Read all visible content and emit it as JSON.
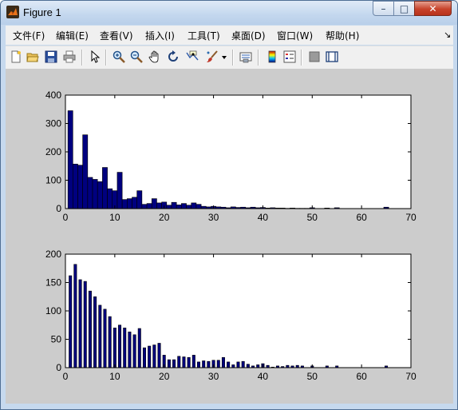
{
  "window": {
    "title": "Figure 1",
    "min_glyph": "–",
    "max_glyph": "□",
    "close_glyph": "✕"
  },
  "menu": {
    "items": [
      "文件(F)",
      "编辑(E)",
      "查看(V)",
      "插入(I)",
      "工具(T)",
      "桌面(D)",
      "窗口(W)",
      "帮助(H)"
    ],
    "dock_glyph": "↘"
  },
  "toolbar": {
    "icons": [
      "new-figure-icon",
      "open-file-icon",
      "save-icon",
      "print-icon",
      "edit-plot-arrow-icon",
      "zoom-in-icon",
      "zoom-out-icon",
      "pan-hand-icon",
      "rotate-3d-icon",
      "data-cursor-icon",
      "brush-icon",
      "brush-dropdown-icon",
      "link-plot-icon",
      "colorbar-icon",
      "legend-icon",
      "hide-plot-tools-icon",
      "show-plot-tools-icon"
    ]
  },
  "colors": {
    "bar_fill": "#00007f",
    "bar_edge": "#000000",
    "figure_bg": "#cccccc",
    "axes_bg": "#ffffff"
  },
  "chart_data": [
    {
      "type": "bar",
      "xlim": [
        0,
        70
      ],
      "ylim": [
        0,
        400
      ],
      "xticks": [
        "0",
        "10",
        "20",
        "30",
        "40",
        "50",
        "60",
        "70"
      ],
      "yticks": [
        "0",
        "100",
        "200",
        "300",
        "400"
      ],
      "bar_width": 1,
      "grid": false,
      "x": [
        1,
        2,
        3,
        4,
        5,
        6,
        7,
        8,
        9,
        10,
        11,
        12,
        13,
        14,
        15,
        16,
        17,
        18,
        19,
        20,
        21,
        22,
        23,
        24,
        25,
        26,
        27,
        28,
        29,
        30,
        31,
        32,
        33,
        34,
        35,
        36,
        37,
        38,
        39,
        40,
        41,
        42,
        43,
        44,
        45,
        46,
        47,
        48,
        49,
        50,
        53,
        55,
        65
      ],
      "values": [
        345,
        157,
        153,
        260,
        110,
        103,
        95,
        145,
        70,
        63,
        128,
        32,
        35,
        40,
        63,
        15,
        18,
        35,
        20,
        23,
        12,
        22,
        13,
        18,
        12,
        20,
        15,
        8,
        6,
        8,
        6,
        5,
        3,
        6,
        4,
        5,
        3,
        5,
        3,
        4,
        2,
        3,
        2,
        2,
        1,
        2,
        1,
        1,
        1,
        3,
        2,
        3,
        5
      ]
    },
    {
      "type": "bar",
      "xlim": [
        0,
        70
      ],
      "ylim": [
        0,
        200
      ],
      "xticks": [
        "0",
        "10",
        "20",
        "30",
        "40",
        "50",
        "60",
        "70"
      ],
      "yticks": [
        "0",
        "50",
        "100",
        "150",
        "200"
      ],
      "bar_width": 0.55,
      "grid": false,
      "x": [
        1,
        2,
        3,
        4,
        5,
        6,
        7,
        8,
        9,
        10,
        11,
        12,
        13,
        14,
        15,
        16,
        17,
        18,
        19,
        20,
        21,
        22,
        23,
        24,
        25,
        26,
        27,
        28,
        29,
        30,
        31,
        32,
        33,
        34,
        35,
        36,
        37,
        38,
        39,
        40,
        41,
        42,
        43,
        44,
        45,
        46,
        47,
        48,
        50,
        53,
        55,
        65
      ],
      "values": [
        162,
        182,
        155,
        152,
        135,
        125,
        110,
        103,
        90,
        70,
        75,
        70,
        63,
        58,
        69,
        35,
        38,
        40,
        43,
        22,
        14,
        14,
        20,
        19,
        18,
        22,
        10,
        12,
        11,
        13,
        13,
        18,
        10,
        5,
        10,
        11,
        6,
        3,
        5,
        7,
        4,
        1,
        3,
        2,
        4,
        3,
        4,
        3,
        3,
        3,
        3,
        3
      ]
    }
  ]
}
